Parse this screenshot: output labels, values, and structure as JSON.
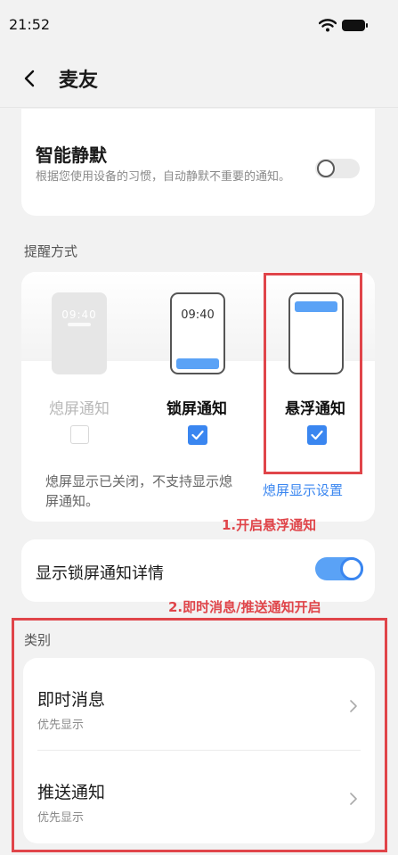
{
  "status_bar": {
    "time": "21:52",
    "icons": [
      "wifi-icon",
      "battery-icon"
    ]
  },
  "header": {
    "title": "麦友",
    "back_icon": "chevron-left-icon"
  },
  "smart_silence": {
    "title": "智能静默",
    "description": "根据您使用设备的习惯，自动静默不重要的通知。",
    "enabled": false
  },
  "reminder": {
    "section_label": "提醒方式",
    "options": [
      {
        "label": "熄屏通知",
        "preview_time": "09:40",
        "checked": false,
        "disabled": true
      },
      {
        "label": "锁屏通知",
        "preview_time": "09:40",
        "checked": true,
        "disabled": false
      },
      {
        "label": "悬浮通知",
        "checked": true,
        "disabled": false
      }
    ],
    "note": "熄屏显示已关闭，不支持显示熄屏通知。",
    "link": "熄屏显示设置"
  },
  "annotations": {
    "step1": "1.开启悬浮通知",
    "step2": "2.即时消息/推送通知开启"
  },
  "lock_details": {
    "label": "显示锁屏通知详情",
    "enabled": true
  },
  "category": {
    "section_label": "类别",
    "items": [
      {
        "title": "即时消息",
        "subtitle": "优先显示"
      },
      {
        "title": "推送通知",
        "subtitle": "优先显示"
      }
    ]
  },
  "colors": {
    "accent": "#3a86f0",
    "annotation": "#e0454a",
    "background": "#f2f2f2"
  }
}
